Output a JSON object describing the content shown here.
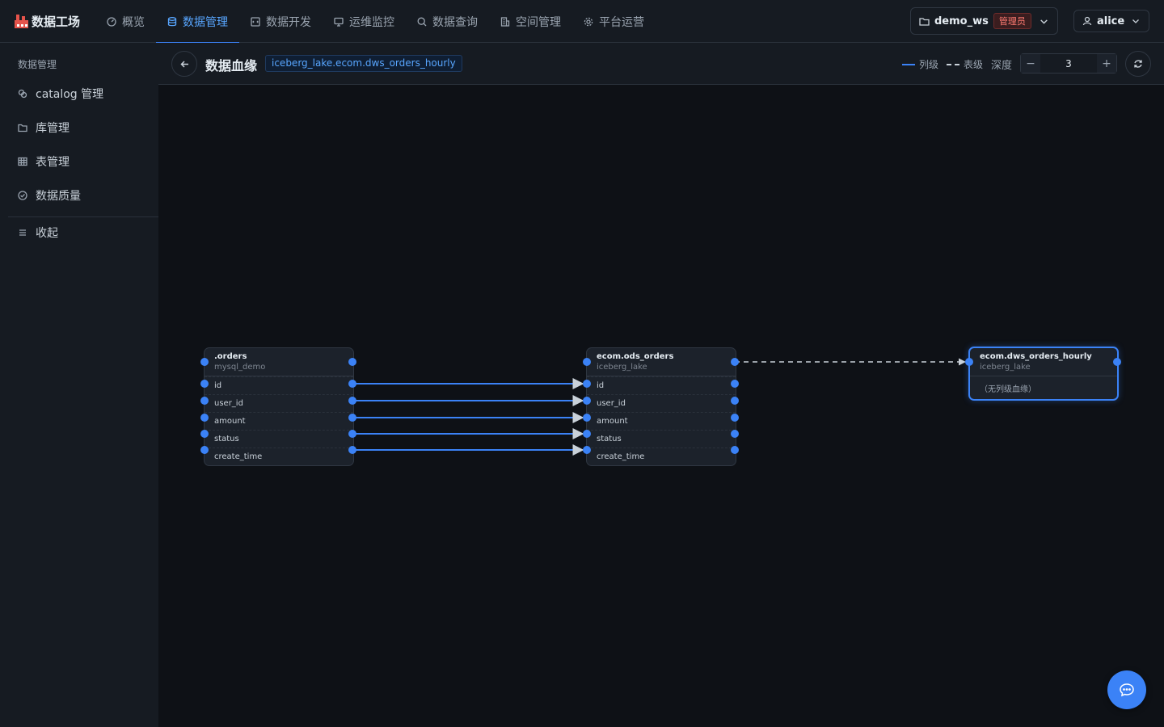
{
  "brand": {
    "name": "数据工场",
    "logo_icon": "factory-icon"
  },
  "nav": [
    {
      "label": "概览",
      "icon": "dashboard-icon",
      "active": false
    },
    {
      "label": "数据管理",
      "icon": "database-icon",
      "active": true
    },
    {
      "label": "数据开发",
      "icon": "code-icon",
      "active": false
    },
    {
      "label": "运维监控",
      "icon": "monitor-icon",
      "active": false
    },
    {
      "label": "数据查询",
      "icon": "search-icon",
      "active": false
    },
    {
      "label": "空间管理",
      "icon": "building-icon",
      "active": false
    },
    {
      "label": "平台运营",
      "icon": "gear-icon",
      "active": false
    }
  ],
  "workspace": {
    "name": "demo_ws",
    "role": "管理员"
  },
  "user": {
    "name": "alice"
  },
  "sidebar": {
    "title": "数据管理",
    "items": [
      {
        "label": "catalog 管理",
        "icon": "catalog-icon"
      },
      {
        "label": "库管理",
        "icon": "folder-icon"
      },
      {
        "label": "表管理",
        "icon": "table-icon"
      },
      {
        "label": "数据质量",
        "icon": "check-circle-icon"
      }
    ],
    "collapse_label": "收起"
  },
  "header": {
    "title": "数据血缘",
    "table_tag": "iceberg_lake.ecom.dws_orders_hourly",
    "legend_column": "列级",
    "legend_table": "表级",
    "depth_label": "深度",
    "depth_value": "3",
    "minus": "−",
    "plus": "+"
  },
  "colors": {
    "accent": "#3b82f6",
    "background": "#0e1116",
    "panel": "#161b22",
    "node": "#1c222b"
  },
  "lineage": {
    "nodes": [
      {
        "name": ".orders",
        "db": "mysql_demo",
        "columns": [
          "id",
          "user_id",
          "amount",
          "status",
          "create_time"
        ]
      },
      {
        "name": "ecom.ods_orders",
        "db": "iceberg_lake",
        "columns": [
          "id",
          "user_id",
          "amount",
          "status",
          "create_time"
        ]
      },
      {
        "name": "ecom.dws_orders_hourly",
        "db": "iceberg_lake",
        "empty_text": "（无列级血缘）",
        "selected": true
      }
    ]
  }
}
